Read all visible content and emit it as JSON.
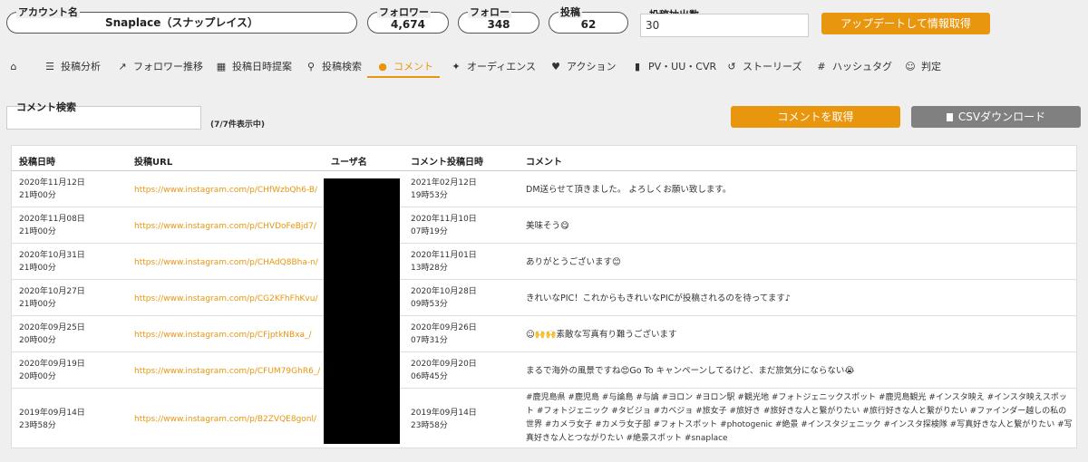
{
  "account": {
    "label": "アカウント名",
    "value": "Snaplace（スナップレイス）"
  },
  "stats": {
    "followers": {
      "label": "フォロワー",
      "value": "4,674"
    },
    "following": {
      "label": "フォロー",
      "value": "348"
    },
    "posts": {
      "label": "投稿",
      "value": "62"
    }
  },
  "extract": {
    "label": "投稿抽出数",
    "value": "30"
  },
  "update_button": "アップデートして情報取得",
  "nav": [
    {
      "icon": "home-icon",
      "glyph": "⌂",
      "label": ""
    },
    {
      "icon": "list-icon",
      "glyph": "☰",
      "label": "投稿分析"
    },
    {
      "icon": "line-chart-icon",
      "glyph": "📈",
      "label": "フォロワー推移"
    },
    {
      "icon": "calendar-icon",
      "glyph": "▦",
      "label": "投稿日時提案"
    },
    {
      "icon": "search-icon",
      "glyph": "⚲",
      "label": "投稿検索"
    },
    {
      "icon": "comment-icon",
      "glyph": "●",
      "label": "コメント"
    },
    {
      "icon": "users-icon",
      "glyph": "👥",
      "label": "オーディエンス"
    },
    {
      "icon": "heart-icon",
      "glyph": "♥",
      "label": "アクション"
    },
    {
      "icon": "bar-chart-icon",
      "glyph": "▮",
      "label": "PV・UU・CVR"
    },
    {
      "icon": "history-icon",
      "glyph": "↺",
      "label": "ストーリーズ"
    },
    {
      "icon": "hashtag-icon",
      "glyph": "#",
      "label": "ハッシュタグ"
    },
    {
      "icon": "user-icon",
      "glyph": "☺",
      "label": "判定"
    }
  ],
  "colors": {
    "accent": "#e8960e",
    "gray_button": "#808080"
  },
  "search": {
    "label": "コメント検索",
    "count": "(7/7件表示中)"
  },
  "get_comments_button": "コメントを取得",
  "csv_button": "CSVダウンロード",
  "table": {
    "headers": {
      "post_date": "投稿日時",
      "post_url": "投稿URL",
      "username": "ユーザ名",
      "comment_date": "コメント投稿日時",
      "comment": "コメント"
    },
    "rows": [
      {
        "date": "2020年11月12日",
        "time": "21時00分",
        "url": "https://www.instagram.com/p/CHfWzbQh6-B/",
        "cdate": "2021年02月12日",
        "ctime": "19時53分",
        "comment": "DM送らせて頂きました。 よろしくお願い致します。"
      },
      {
        "date": "2020年11月08日",
        "time": "21時00分",
        "url": "https://www.instagram.com/p/CHVDoFeBjd7/",
        "cdate": "2020年11月10日",
        "ctime": "07時19分",
        "comment": "美味そう😋"
      },
      {
        "date": "2020年10月31日",
        "time": "21時00分",
        "url": "https://www.instagram.com/p/CHAdQ8Bha-n/",
        "cdate": "2020年11月01日",
        "ctime": "13時28分",
        "comment": "ありがとうございます😊"
      },
      {
        "date": "2020年10月27日",
        "time": "21時00分",
        "url": "https://www.instagram.com/p/CG2KFhFhKvu/",
        "cdate": "2020年10月28日",
        "ctime": "09時53分",
        "comment": "きれいなPIC！これからもきれいなPICが投稿されるのを待ってます♪"
      },
      {
        "date": "2020年09月25日",
        "time": "20時00分",
        "url": "https://www.instagram.com/p/CFjptkNBxa_/",
        "cdate": "2020年09月26日",
        "ctime": "07時31分",
        "comment": "☺🙌🙌素敵な写真有り難うございます"
      },
      {
        "date": "2020年09月19日",
        "time": "20時00分",
        "url": "https://www.instagram.com/p/CFUM79GhR6_/",
        "cdate": "2020年09月20日",
        "ctime": "06時45分",
        "comment": "まるで海外の風景ですね😍Go To キャンペーンしてるけど、まだ旅気分にならない😭"
      },
      {
        "date": "2019年09月14日",
        "time": "23時58分",
        "url": "https://www.instagram.com/p/B2ZVQE8gonl/",
        "cdate": "2019年09月14日",
        "ctime": "23時58分",
        "comment": "#鹿児島県 #鹿児島 #与論島 #与論 #ヨロン #ヨロン駅 #観光地 #フォトジェニックスポット #鹿児島観光 #インスタ映え #インスタ映えスポット #フォトジェニック #タビジョ #カベジョ #旅女子 #旅好き #旅好きな人と繋がりたい #旅行好きな人と繋がりたい #ファインダー越しの私の世界 #カメラ女子 #カメラ女子部 #フォトスポット #photogenic #絶景 #インスタジェニック #インスタ探検隊 #写真好きな人と繋がりたい #写真好きな人とつながりたい #絶景スポット #snaplace"
      }
    ]
  }
}
